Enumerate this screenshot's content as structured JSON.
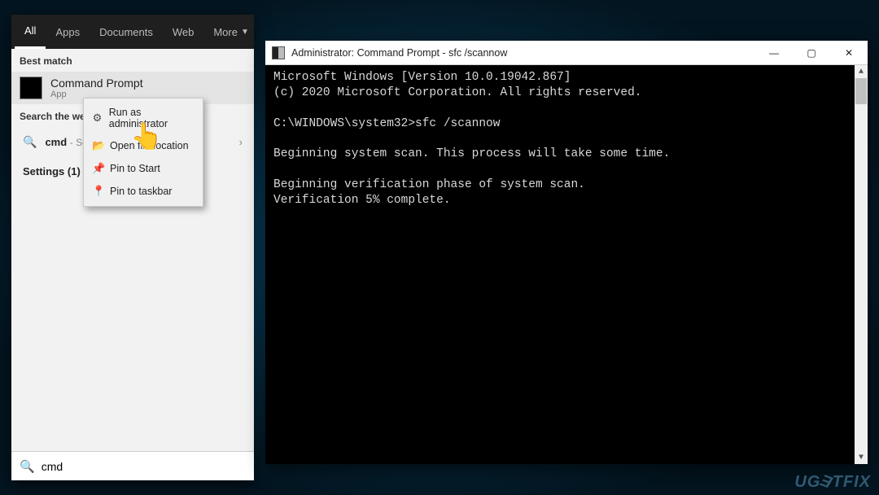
{
  "search_panel": {
    "tabs": [
      "All",
      "Apps",
      "Documents",
      "Web",
      "More"
    ],
    "best_match_label": "Best match",
    "app": {
      "title": "Command Prompt",
      "subtitle": "App"
    },
    "search_web_label": "Search the web",
    "web_item": {
      "term": "cmd",
      "sub": "- See web results"
    },
    "settings_label": "Settings (1)",
    "search_input_value": "cmd"
  },
  "context_menu": {
    "items": [
      {
        "icon": "⚙",
        "label": "Run as administrator",
        "name": "run-as-admin"
      },
      {
        "icon": "📂",
        "label": "Open file location",
        "name": "open-file-location"
      },
      {
        "icon": "📌",
        "label": "Pin to Start",
        "name": "pin-to-start"
      },
      {
        "icon": "📍",
        "label": "Pin to taskbar",
        "name": "pin-to-taskbar"
      }
    ]
  },
  "cmd_window": {
    "title": "Administrator: Command Prompt - sfc  /scannow",
    "lines": [
      "Microsoft Windows [Version 10.0.19042.867]",
      "(c) 2020 Microsoft Corporation. All rights reserved.",
      "",
      "C:\\WINDOWS\\system32>sfc /scannow",
      "",
      "Beginning system scan.  This process will take some time.",
      "",
      "Beginning verification phase of system scan.",
      "Verification 5% complete."
    ]
  },
  "watermark": "UGETFIX"
}
